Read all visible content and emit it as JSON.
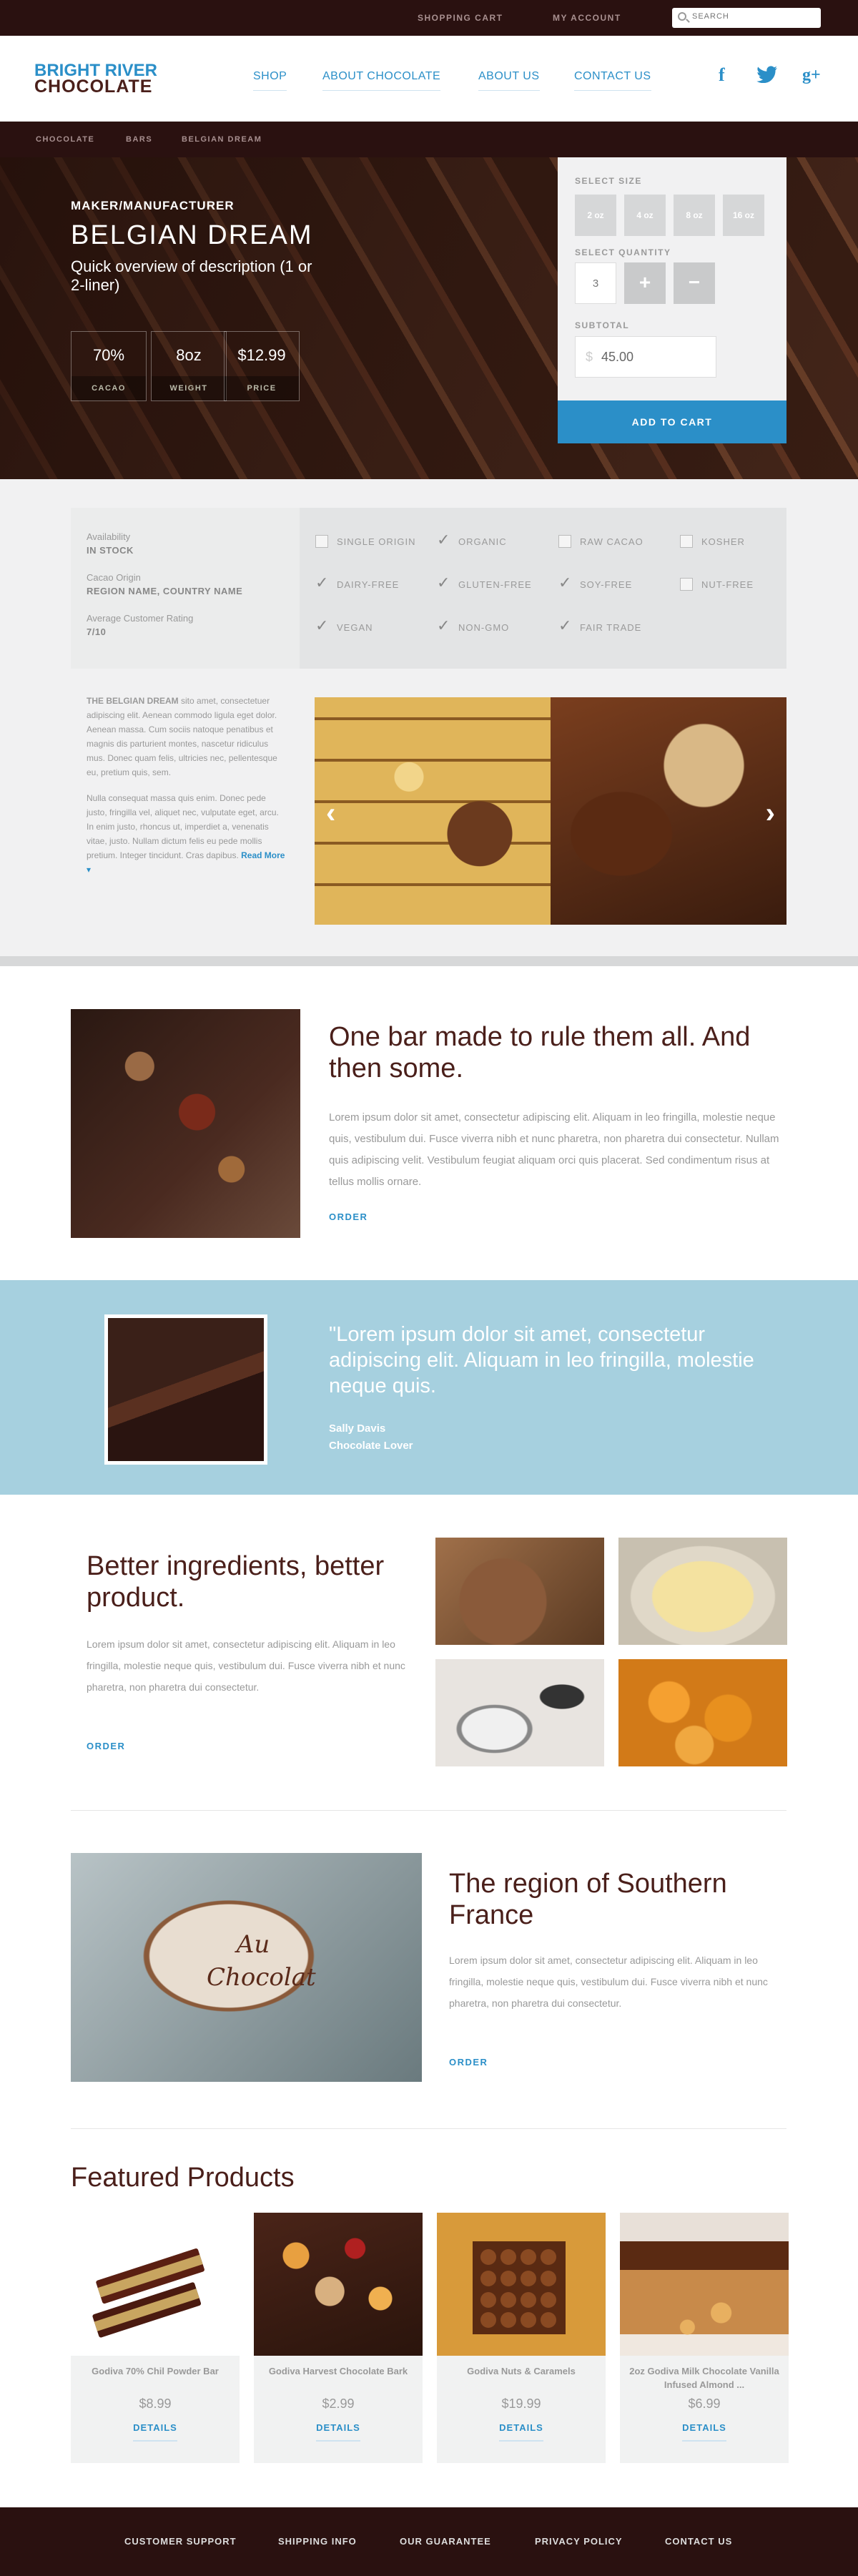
{
  "topbar": {
    "cart": "SHOPPING CART",
    "account": "MY ACCOUNT",
    "search_placeholder": "SEARCH"
  },
  "logo": {
    "line1": "BRIGHT RIVER",
    "line2": "CHOCOLATE"
  },
  "nav": {
    "items": [
      {
        "label": "SHOP"
      },
      {
        "label": "ABOUT CHOCOLATE"
      },
      {
        "label": "ABOUT US"
      },
      {
        "label": "CONTACT US"
      }
    ]
  },
  "social": {
    "facebook": "f",
    "twitter": "t",
    "googleplus": "g+"
  },
  "breadcrumb": [
    "CHOCOLATE",
    "BARS",
    "BELGIAN DREAM"
  ],
  "hero": {
    "maker": "MAKER/MANUFACTURER",
    "title": "BELGIAN DREAM",
    "subtitle": "Quick overview of description (1 or 2-liner)",
    "stats": [
      {
        "value": "70%",
        "label": "CACAO"
      },
      {
        "value": "8oz",
        "label": "WEIGHT"
      },
      {
        "value": "$12.99",
        "label": "PRICE"
      }
    ]
  },
  "buy": {
    "size_label": "SELECT SIZE",
    "sizes": [
      "2 oz",
      "4 oz",
      "8 oz",
      "16 oz"
    ],
    "qty_label": "SELECT QUANTITY",
    "qty": "3",
    "plus": "+",
    "minus": "−",
    "subtotal_label": "SUBTOTAL",
    "subtotal": "45.00",
    "add_to_cart": "ADD TO CART"
  },
  "attributes": {
    "availability_label": "Availability",
    "availability": "IN STOCK",
    "origin_label": "Cacao Origin",
    "origin": "REGION NAME, COUNTRY NAME",
    "rating_label": "Average Customer Rating",
    "rating": "7/10",
    "checks": [
      {
        "label": "SINGLE ORIGIN",
        "checked": false
      },
      {
        "label": "ORGANIC",
        "checked": true
      },
      {
        "label": "RAW CACAO",
        "checked": false
      },
      {
        "label": "KOSHER",
        "checked": false
      },
      {
        "label": "DAIRY-FREE",
        "checked": true
      },
      {
        "label": "GLUTEN-FREE",
        "checked": true
      },
      {
        "label": "SOY-FREE",
        "checked": true
      },
      {
        "label": "NUT-FREE",
        "checked": false
      },
      {
        "label": "VEGAN",
        "checked": true
      },
      {
        "label": "NON-GMO",
        "checked": true
      },
      {
        "label": "FAIR TRADE",
        "checked": true
      }
    ]
  },
  "description": {
    "lead": "THE BELGIAN DREAM",
    "p1": "sito amet, consectetuer adipiscing elit. Aenean commodo ligula eget dolor. Aenean massa. Cum sociis natoque penatibus et magnis dis parturient montes, nascetur ridiculus mus. Donec quam felis, ultricies nec, pellentesque eu, pretium quis, sem.",
    "p2": "Nulla consequat massa quis enim. Donec pede justo, fringilla vel, aliquet nec, vulputate eget, arcu. In enim justo, rhoncus ut, imperdiet a, venenatis vitae, justo. Nullam dictum felis eu pede mollis pretium. Integer tincidunt. Cras dapibus.",
    "read_more": "Read More"
  },
  "feature1": {
    "title": "One bar made to rule them all. And then some.",
    "body": "Lorem ipsum dolor sit amet, consectetur adipiscing elit. Aliquam in leo fringilla, molestie neque quis, vestibulum dui. Fusce viverra nibh et nunc pharetra, non pharetra dui consectetur. Nullam quis adipiscing velit. Vestibulum feugiat aliquam orci quis placerat. Sed condimentum risus at tellus mollis ornare.",
    "cta": "ORDER"
  },
  "quote": {
    "text": "\"Lorem ipsum dolor sit amet, consectetur adipiscing elit. Aliquam in leo fringilla, molestie neque quis.",
    "name": "Sally Davis",
    "role": "Chocolate Lover"
  },
  "feature2": {
    "title": "Better ingredients, better product.",
    "body": "Lorem ipsum dolor sit amet, consectetur adipiscing elit. Aliquam in leo fringilla, molestie neque quis, vestibulum dui. Fusce viverra nibh et nunc pharetra, non pharetra dui consectetur.",
    "cta": "ORDER"
  },
  "feature3": {
    "title": "The region of Southern France",
    "body": "Lorem ipsum dolor sit amet, consectetur adipiscing elit. Aliquam in leo fringilla, molestie neque quis, vestibulum dui. Fusce viverra nibh et nunc pharetra, non pharetra dui consectetur.",
    "cta": "ORDER",
    "sign": "Au Chocolat"
  },
  "featured": {
    "title": "Featured Products",
    "products": [
      {
        "name": "Godiva 70% Chil Powder Bar",
        "price": "$8.99",
        "cta": "DETAILS"
      },
      {
        "name": "Godiva Harvest Chocolate Bark",
        "price": "$2.99",
        "cta": "DETAILS"
      },
      {
        "name": "Godiva Nuts & Caramels",
        "price": "$19.99",
        "cta": "DETAILS"
      },
      {
        "name": "2oz Godiva Milk Chocolate Vanilla Infused Almond ...",
        "price": "$6.99",
        "cta": "DETAILS"
      }
    ]
  },
  "footer": {
    "links": [
      "CUSTOMER SUPPORT",
      "SHIPPING INFO",
      "OUR GUARANTEE",
      "PRIVACY POLICY",
      "CONTACT US"
    ]
  },
  "colors": {
    "accent": "#2b8fc8",
    "dark": "#2a1110",
    "quote_bg": "#a6d0df"
  }
}
